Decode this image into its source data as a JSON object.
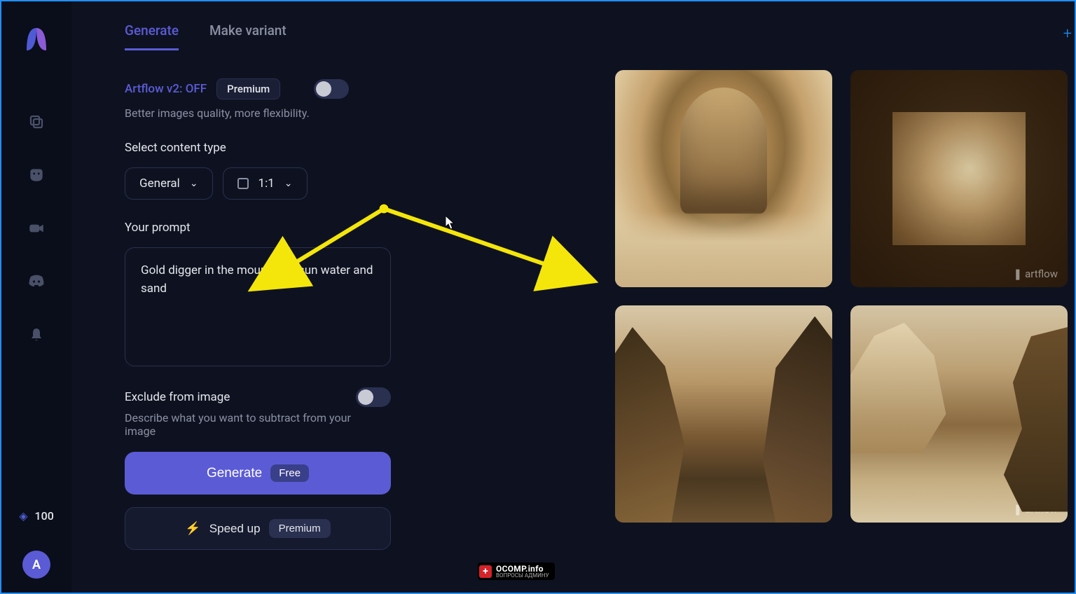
{
  "sidebar": {
    "credits": "100",
    "avatar_initial": "A"
  },
  "tabs": [
    {
      "label": "Generate",
      "active": true
    },
    {
      "label": "Make variant",
      "active": false
    }
  ],
  "model": {
    "label": "Artflow v2: OFF",
    "badge": "Premium",
    "subtext": "Better images quality, more flexibility."
  },
  "content_type": {
    "label": "Select content type",
    "type_value": "General",
    "aspect_value": "1:1"
  },
  "prompt": {
    "label": "Your prompt",
    "value": "Gold digger in the mountains, sun water and sand"
  },
  "exclude": {
    "label": "Exclude from image",
    "subtext": "Describe what you want to subtract from your image"
  },
  "buttons": {
    "generate": "Generate",
    "generate_badge": "Free",
    "speedup": "Speed up",
    "speedup_badge": "Premium"
  },
  "watermark": "artflow",
  "ocomp": {
    "title": "OCOMP.info",
    "sub": "ВОПРОСЫ АДМИНУ"
  }
}
